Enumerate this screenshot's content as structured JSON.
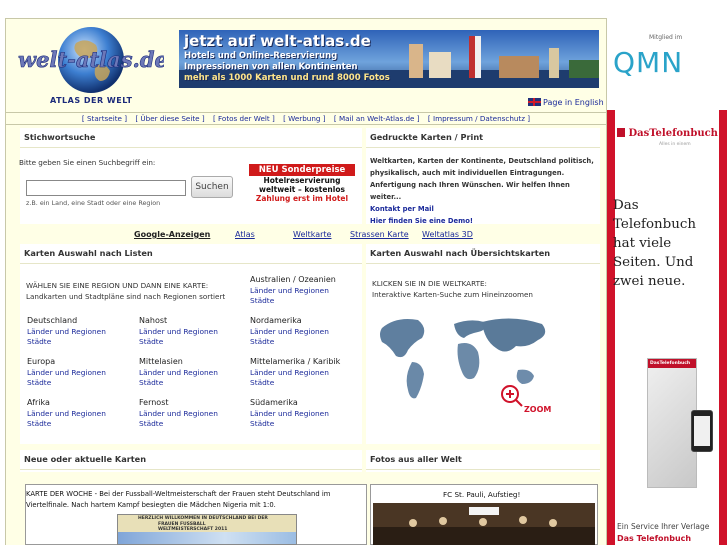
{
  "header": {
    "logo_text": "welt-atlas.de",
    "logo_sub": "ATLAS DER WELT",
    "banner": {
      "line1": "jetzt auf welt-atlas.de",
      "line2": "Hotels und Online-Reservierung",
      "line3": "Impressionen von allen Kontinenten",
      "line4": "mehr als 1000 Karten und rund 8000 Fotos"
    },
    "english_link": "Page in English"
  },
  "nav": {
    "items": [
      "[ Startseite ]",
      "[ Über diese Seite ]",
      "[ Fotos der Welt ]",
      "[ Werbung ]",
      "[ Mail an Welt-Atlas.de ]",
      "[ Impressum / Datenschutz ]"
    ]
  },
  "search": {
    "title": "Stichwortsuche",
    "label": "Bitte geben Sie einen Suchbegriff ein:",
    "input_value": "",
    "button": "Suchen",
    "hint": "z.B. ein Land, eine Stadt oder eine Region"
  },
  "promo": {
    "tag": "NEU  Sonderpreise",
    "line1": "Hotelreservierung",
    "line2": "weltweit – kostenlos",
    "line3": "Zahlung erst im Hotel"
  },
  "print": {
    "title": "Gedruckte Karten / Print",
    "text": "Weltkarten, Karten der Kontinente, Deutschland politisch, physikalisch, auch mit individuellen Eintragungen. Anfertigung nach Ihren Wünschen. Wir helfen Ihnen weiter...",
    "contact": "Kontakt per Mail",
    "demo": "Hier finden Sie eine Demo!"
  },
  "tabs": [
    "Google-Anzeigen",
    "Atlas",
    "Weltkarte",
    "Strassen Karte",
    "Weltatlas 3D"
  ],
  "lists": {
    "title": "Karten Auswahl nach Listen",
    "intro1": "WÄHLEN SIE EINE REGION UND DANN EINE KARTE:",
    "intro2": "Landkarten und Stadtpläne sind nach Regionen sortiert",
    "link1": "Länder und Regionen",
    "link2": "Städte",
    "regions": [
      "Deutschland",
      "Nahost",
      "Australien / Ozeanien",
      "Nordamerika",
      "Europa",
      "Mittelasien",
      "Mittelamerika / Karibik",
      "Afrika",
      "Fernost",
      "Südamerika"
    ]
  },
  "overview": {
    "title": "Karten Auswahl nach Übersichtskarten",
    "intro1": "KLICKEN SIE IN DIE WELTKARTE:",
    "intro2": "Interaktive Karten-Suche zum Hineinzoomen",
    "zoom": "ZOOM"
  },
  "news": {
    "title": "Neue oder aktuelle Karten",
    "text": "KARTE DER WOCHE - Bei der Fussball-Weltmeisterschaft der Frauen steht Deutschland im Viertelfinale. Nach hartem Kampf besiegten die Mädchen Nigeria mit 1:0.",
    "img_text1": "HERZLICH WILLKOMMEN IN DEUTSCHLAND BEI DER",
    "img_text2": "FRAUEN FUSSBALL WELTMEISTERSCHAFT 2011"
  },
  "photos": {
    "title": "Fotos aus aller Welt",
    "caption": "FC St. Pauli, Aufstieg!"
  },
  "ads": {
    "member_label": "Mitglied im",
    "qmn": "QMN",
    "tb_brand": "DasTelefonbuch",
    "tb_sub": "Alles in einem",
    "tb_headline": "Das Telefonbuch hat viele Seiten. Und zwei neue.",
    "tb_footer1": "Ein Service Ihrer Verlage",
    "tb_footer2": "Das Telefonbuch",
    "book_title": "DasTelefonbuch"
  },
  "colors": {
    "page_bg": "#ffffe6",
    "link": "#1b2a9a",
    "accent_red": "#d0122a",
    "qmn_blue": "#2aa3c9"
  }
}
